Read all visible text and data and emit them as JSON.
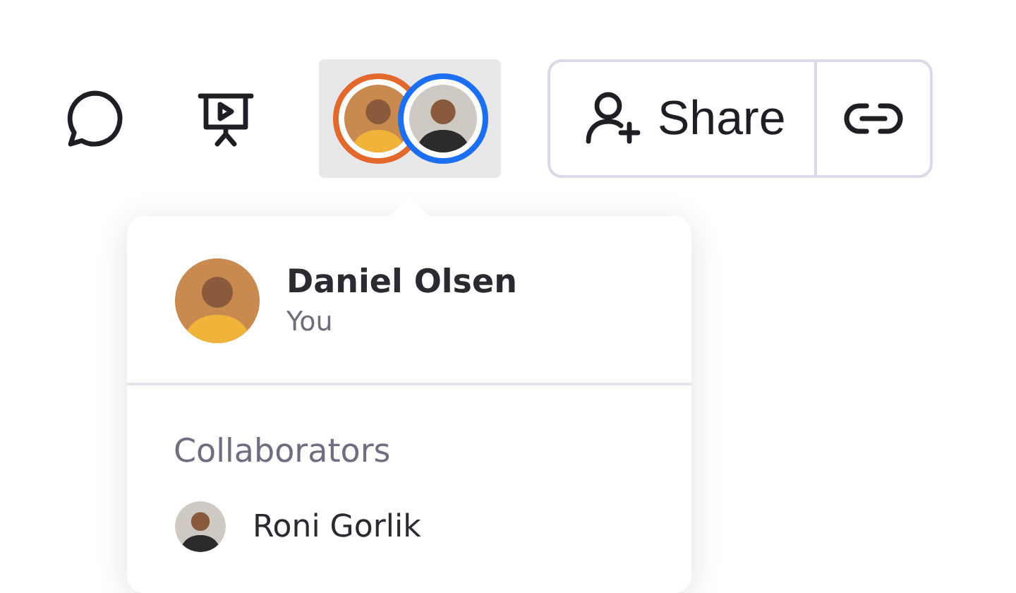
{
  "toolbar": {
    "avatar_group": {
      "expanded": true,
      "avatars": [
        {
          "color": "#e2692b"
        },
        {
          "color": "#1c6ef2"
        }
      ]
    },
    "share": {
      "label": "Share"
    }
  },
  "popup": {
    "user": {
      "name": "Daniel Olsen",
      "note": "You"
    },
    "section_title": "Collaborators",
    "collaborators": [
      {
        "name": "Roni Gorlik"
      }
    ]
  }
}
